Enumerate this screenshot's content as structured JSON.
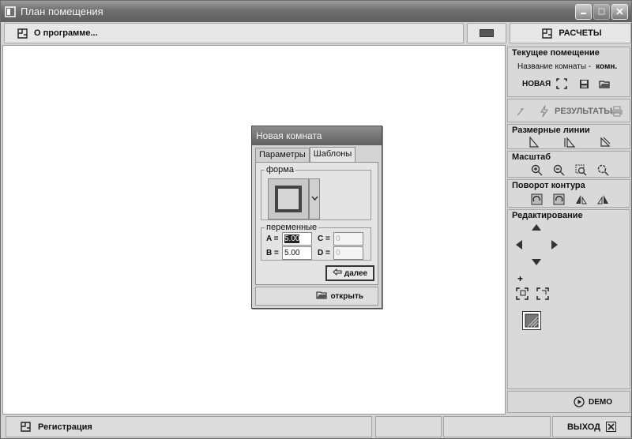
{
  "window": {
    "title": "План помещения"
  },
  "toolbar": {
    "about_label": "О программе...",
    "calc_label": "РАСЧЕТЫ"
  },
  "current_room": {
    "title": "Текущее помещение",
    "name_label": "Название комнаты -",
    "name_value": "комн.",
    "new_label": "НОВАЯ"
  },
  "results": {
    "label": "РЕЗУЛЬТАТЫ"
  },
  "dimension_lines": {
    "title": "Размерные линии"
  },
  "scale": {
    "title": "Масштаб"
  },
  "rotation": {
    "title": "Поворот контура"
  },
  "editing": {
    "title": "Редактирование",
    "plus": "+"
  },
  "demo": {
    "label": "DEMO"
  },
  "status": {
    "registration_label": "Регистрация",
    "exit_label": "ВЫХОД"
  },
  "dialog": {
    "title": "Новая комната",
    "tabs": [
      {
        "label": "Параметры"
      },
      {
        "label": "Шаблоны"
      }
    ],
    "shape_legend": "форма",
    "vars_legend": "переменные",
    "vars": [
      {
        "label": "A =",
        "value": "5.00"
      },
      {
        "label": "B =",
        "value": "5.00"
      },
      {
        "label": "C =",
        "value": "0"
      },
      {
        "label": "D =",
        "value": "0"
      }
    ],
    "next_label": "далее",
    "open_label": "открыть"
  }
}
